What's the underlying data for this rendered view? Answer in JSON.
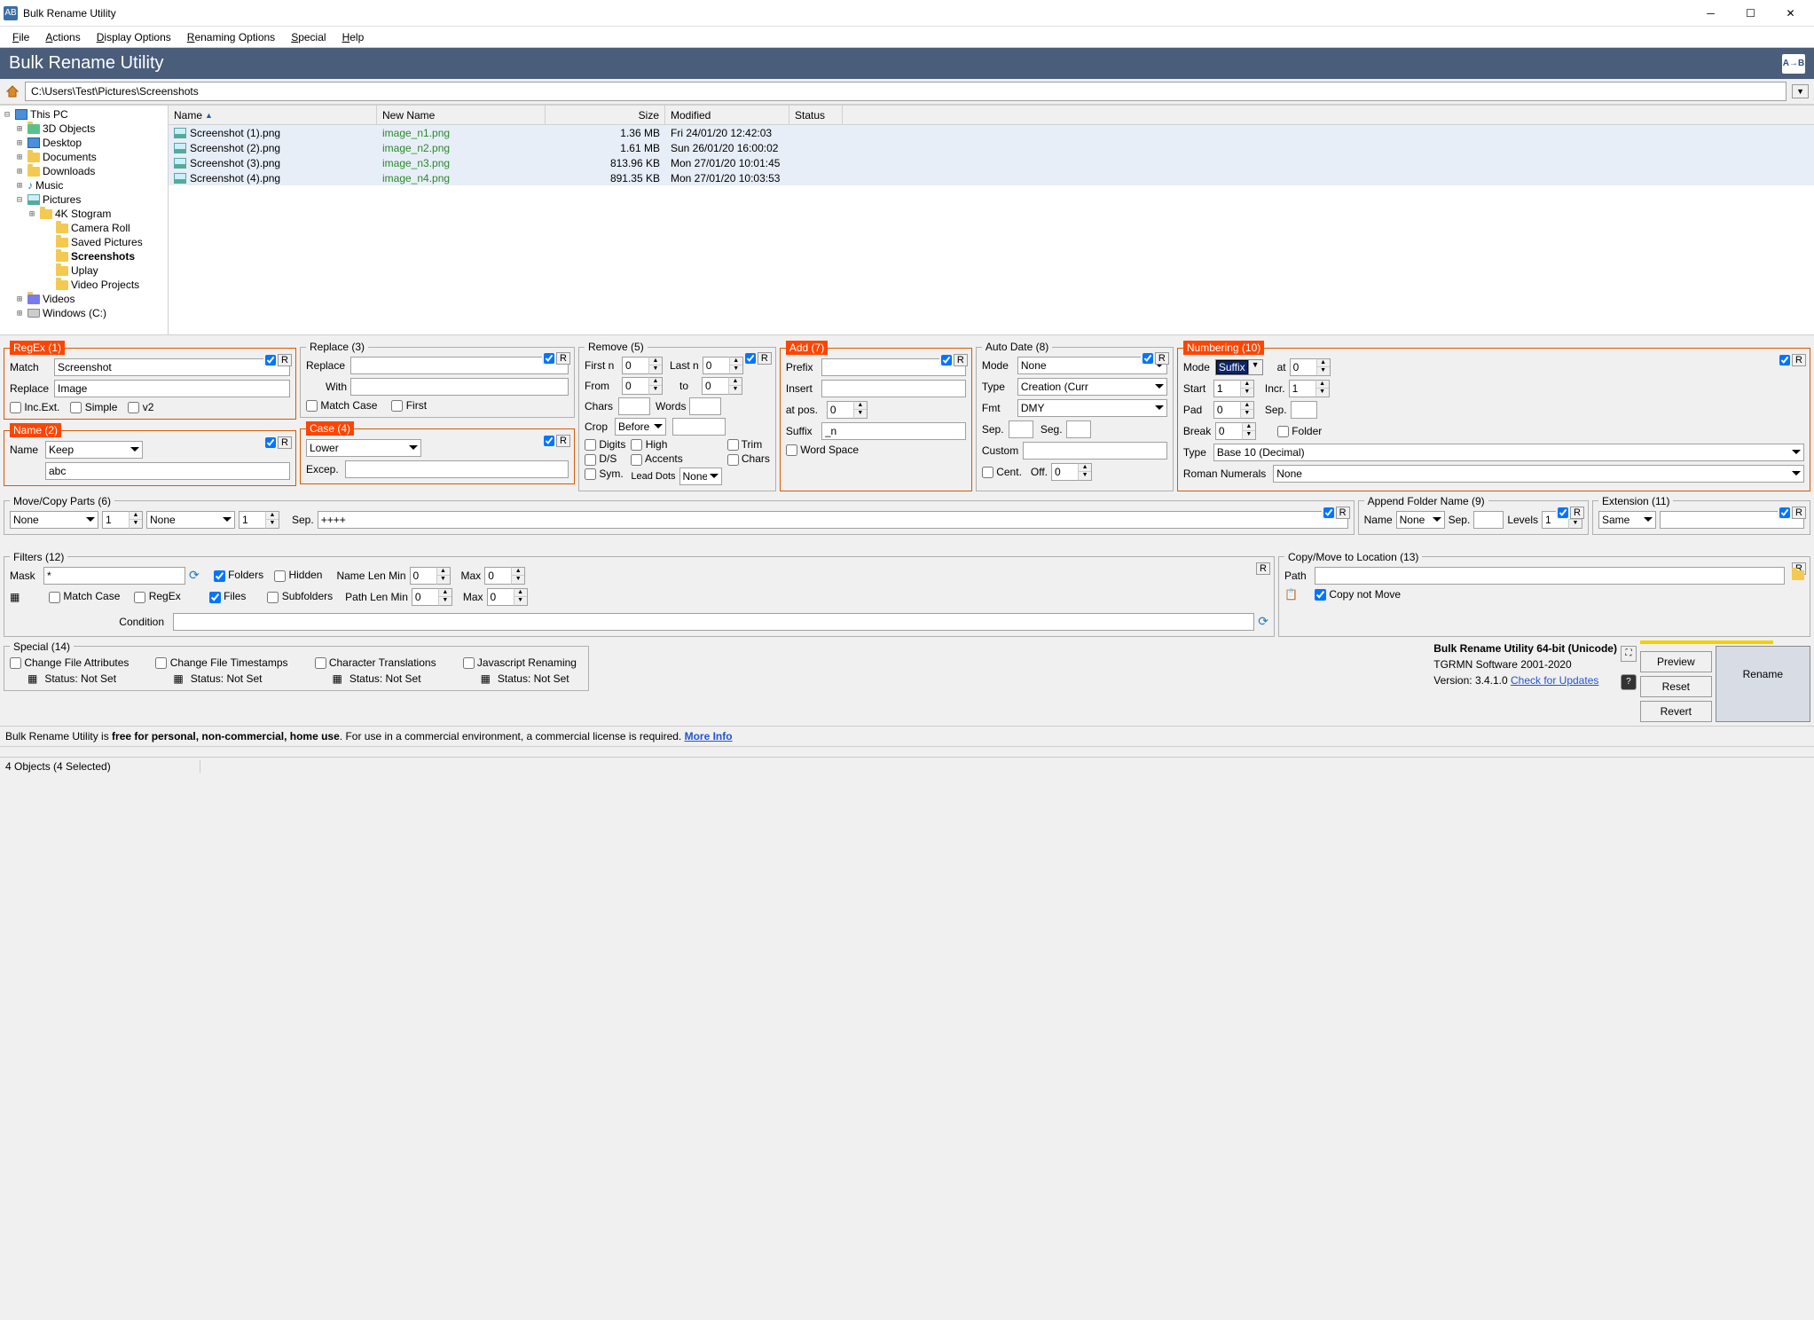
{
  "window": {
    "title": "Bulk Rename Utility"
  },
  "menu": {
    "file": "File",
    "actions": "Actions",
    "display": "Display Options",
    "renaming": "Renaming Options",
    "special": "Special",
    "help": "Help"
  },
  "header": {
    "title": "Bulk Rename Utility"
  },
  "path": "C:\\Users\\Test\\Pictures\\Screenshots",
  "tree": {
    "root": "This PC",
    "items": [
      "3D Objects",
      "Desktop",
      "Documents",
      "Downloads",
      "Music",
      "Pictures",
      "Videos",
      "Windows (C:)"
    ],
    "pics": [
      "4K Stogram",
      "Camera Roll",
      "Saved Pictures",
      "Screenshots",
      "Uplay",
      "Video Projects"
    ]
  },
  "cols": {
    "name": "Name",
    "new": "New Name",
    "size": "Size",
    "mod": "Modified",
    "status": "Status"
  },
  "rows": [
    {
      "name": "Screenshot (1).png",
      "new": "image_n1.png",
      "size": "1.36 MB",
      "mod": "Fri 24/01/20 12:42:03"
    },
    {
      "name": "Screenshot (2).png",
      "new": "image_n2.png",
      "size": "1.61 MB",
      "mod": "Sun 26/01/20 16:00:02"
    },
    {
      "name": "Screenshot (3).png",
      "new": "image_n3.png",
      "size": "813.96 KB",
      "mod": "Mon 27/01/20 10:01:45"
    },
    {
      "name": "Screenshot (4).png",
      "new": "image_n4.png",
      "size": "891.35 KB",
      "mod": "Mon 27/01/20 10:03:53"
    }
  ],
  "regex": {
    "title": "RegEx (1)",
    "match_l": "Match",
    "match_v": "Screenshot",
    "repl_l": "Replace",
    "repl_v": "Image",
    "inc": "Inc.Ext.",
    "simple": "Simple",
    "v2": "v2"
  },
  "name": {
    "title": "Name (2)",
    "label": "Name",
    "mode": "Keep",
    "value": "abc"
  },
  "replace": {
    "title": "Replace (3)",
    "repl": "Replace",
    "with": "With",
    "mc": "Match Case",
    "first": "First"
  },
  "case": {
    "title": "Case (4)",
    "mode": "Lower",
    "excep": "Excep."
  },
  "remove": {
    "title": "Remove (5)",
    "firstn": "First n",
    "lastn": "Last n",
    "from": "From",
    "to": "to",
    "chars": "Chars",
    "words": "Words",
    "crop": "Crop",
    "crop_v": "Before",
    "digits": "Digits",
    "high": "High",
    "ds": "D/S",
    "accents": "Accents",
    "sym": "Sym.",
    "lead": "Lead Dots",
    "lead_v": "None",
    "trim": "Trim",
    "chars2": "Chars",
    "zeros": {
      "fn": "0",
      "ln": "0",
      "fr": "0",
      "to": "0"
    }
  },
  "add": {
    "title": "Add (7)",
    "prefix": "Prefix",
    "insert": "Insert",
    "atpos": "at pos.",
    "suffix": "Suffix",
    "suffix_v": "_n",
    "ws": "Word Space",
    "pos": "0"
  },
  "autodate": {
    "title": "Auto Date (8)",
    "mode": "Mode",
    "mode_v": "None",
    "type": "Type",
    "type_v": "Creation (Curr",
    "fmt": "Fmt",
    "fmt_v": "DMY",
    "sep": "Sep.",
    "seg": "Seg.",
    "custom": "Custom",
    "cent": "Cent.",
    "off": "Off.",
    "off_v": "0"
  },
  "numbering": {
    "title": "Numbering (10)",
    "mode": "Mode",
    "mode_v": "Suffix",
    "at": "at",
    "at_v": "0",
    "start": "Start",
    "start_v": "1",
    "incr": "Incr.",
    "incr_v": "1",
    "pad": "Pad",
    "pad_v": "0",
    "sep": "Sep.",
    "break": "Break",
    "break_v": "0",
    "folder": "Folder",
    "type": "Type",
    "type_v": "Base 10 (Decimal)",
    "roman": "Roman Numerals",
    "roman_v": "None"
  },
  "move": {
    "title": "Move/Copy Parts (6)",
    "none": "None",
    "sep": "Sep.",
    "sep_v": "++++",
    "n1": "1",
    "n2": "1"
  },
  "append": {
    "title": "Append Folder Name (9)",
    "name": "Name",
    "name_v": "None",
    "sep": "Sep.",
    "levels": "Levels",
    "levels_v": "1"
  },
  "ext": {
    "title": "Extension (11)",
    "same": "Same"
  },
  "filters": {
    "title": "Filters (12)",
    "mask": "Mask",
    "mask_v": "*",
    "folders": "Folders",
    "hidden": "Hidden",
    "files": "Files",
    "subfolders": "Subfolders",
    "mc": "Match Case",
    "regex": "RegEx",
    "nlm": "Name Len Min",
    "plm": "Path Len Min",
    "max": "Max",
    "cond": "Condition",
    "zero": "0"
  },
  "copy": {
    "title": "Copy/Move to Location (13)",
    "path": "Path",
    "cnm": "Copy not Move"
  },
  "special": {
    "title": "Special (14)",
    "cfa": "Change File Attributes",
    "cft": "Change File Timestamps",
    "ct": "Character Translations",
    "jr": "Javascript Renaming",
    "status": "Status:  Not Set"
  },
  "version": {
    "l1": "Bulk Rename Utility 64-bit (Unicode)",
    "l2": "TGRMN Software 2001-2020",
    "l3": "Version: 3.4.1.0 ",
    "link": "Check for Updates"
  },
  "buttons": {
    "preview": "Preview",
    "reset": "Reset",
    "revert": "Revert",
    "rename": "Rename"
  },
  "footer": {
    "t1": "Bulk Rename Utility is ",
    "t2": "free for personal, non-commercial, home use",
    "t3": ". For use in a commercial environment, a commercial license is required. ",
    "link": "More Info"
  },
  "status": "4 Objects (4 Selected)"
}
